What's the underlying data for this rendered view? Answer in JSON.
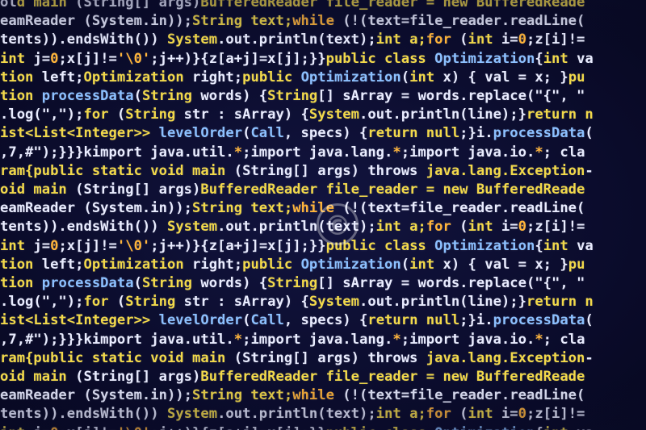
{
  "lines": [
    [
      [
        "w",
        "ol"
      ],
      [
        "y",
        "d main "
      ],
      [
        "w",
        "(String[] args)"
      ],
      [
        "y",
        "BufferedReader file_reader = new BufferedReade"
      ]
    ],
    [
      [
        "w",
        "eamReader (System.in));"
      ],
      [
        "y",
        "String text;"
      ],
      [
        "o",
        "while"
      ],
      [
        "w",
        " (!(text=file_reader.readLine("
      ]
    ],
    [
      [
        "w",
        "tents)).endsWith()) "
      ],
      [
        "y",
        "System"
      ],
      [
        "w",
        ".out.println(text);"
      ],
      [
        "y",
        "int a;"
      ],
      [
        "o",
        "for"
      ],
      [
        "w",
        " ("
      ],
      [
        "y",
        "int"
      ],
      [
        "w",
        " i="
      ],
      [
        "o",
        "0"
      ],
      [
        "w",
        ";z[i]!="
      ]
    ],
    [
      [
        "y",
        "int"
      ],
      [
        "w",
        " j="
      ],
      [
        "o",
        "0"
      ],
      [
        "w",
        ";x[j]!="
      ],
      [
        "o",
        "'\\0'"
      ],
      [
        "w",
        ";j++)}{z[a+j]=x[j];}}"
      ],
      [
        "y",
        "public class "
      ],
      [
        "b",
        "Optimization"
      ],
      [
        "w",
        "{"
      ],
      [
        "y",
        "int"
      ],
      [
        "w",
        " va"
      ]
    ],
    [
      [
        "y",
        "tion"
      ],
      [
        "w",
        " left;"
      ],
      [
        "y",
        "Optimization"
      ],
      [
        "w",
        " right;"
      ],
      [
        "y",
        "public "
      ],
      [
        "b",
        "Optimization"
      ],
      [
        "w",
        "("
      ],
      [
        "y",
        "int"
      ],
      [
        "w",
        " x) { val = x; }"
      ],
      [
        "y",
        "pu"
      ]
    ],
    [
      [
        "y",
        "tion "
      ],
      [
        "b",
        "processData"
      ],
      [
        "w",
        "("
      ],
      [
        "y",
        "String"
      ],
      [
        "w",
        " words) {"
      ],
      [
        "y",
        "String"
      ],
      [
        "w",
        "[] sArray = words.replace(\"{\", \""
      ]
    ],
    [
      [
        "w",
        ".log(\",\");"
      ],
      [
        "y",
        "for"
      ],
      [
        "w",
        " ("
      ],
      [
        "y",
        "String"
      ],
      [
        "w",
        " str : sArray) {"
      ],
      [
        "y",
        "System"
      ],
      [
        "w",
        ".out.println(line);}"
      ],
      [
        "y",
        "return n"
      ]
    ],
    [
      [
        "y",
        "ist<List<Integer>> "
      ],
      [
        "b",
        "levelOrder"
      ],
      [
        "w",
        "("
      ],
      [
        "b",
        "Call"
      ],
      [
        "w",
        ", specs) {"
      ],
      [
        "y",
        "return null"
      ],
      [
        "w",
        ";}i."
      ],
      [
        "b",
        "processData"
      ],
      [
        "w",
        "("
      ]
    ],
    [
      [
        "w",
        ",7,#\");}}}kimport java.util."
      ],
      [
        "o",
        "*"
      ],
      [
        "w",
        ";import java.lang."
      ],
      [
        "o",
        "*"
      ],
      [
        "w",
        ";import java.io."
      ],
      [
        "o",
        "*"
      ],
      [
        "w",
        "; cla"
      ]
    ],
    [
      [
        "y",
        "ram{public static void main "
      ],
      [
        "w",
        "(String[] args) throws "
      ],
      [
        "y",
        "java.lang.Exception"
      ],
      [
        "w",
        "-"
      ]
    ],
    [
      [
        "y",
        "oid main "
      ],
      [
        "w",
        "(String[] args)"
      ],
      [
        "y",
        "BufferedReader file_reader = new BufferedReade"
      ]
    ],
    [
      [
        "w",
        "eamReader (System.in));"
      ],
      [
        "y",
        "String text;"
      ],
      [
        "o",
        "while"
      ],
      [
        "w",
        " (!(text=file_reader.readLine("
      ]
    ],
    [
      [
        "w",
        "tents)).endsWith()) "
      ],
      [
        "y",
        "System"
      ],
      [
        "w",
        ".out.println(text);"
      ],
      [
        "y",
        "int a;"
      ],
      [
        "o",
        "for"
      ],
      [
        "w",
        " ("
      ],
      [
        "y",
        "int"
      ],
      [
        "w",
        " i="
      ],
      [
        "o",
        "0"
      ],
      [
        "w",
        ";z[i]!="
      ]
    ],
    [
      [
        "y",
        "int"
      ],
      [
        "w",
        " j="
      ],
      [
        "o",
        "0"
      ],
      [
        "w",
        ";x[j]!="
      ],
      [
        "o",
        "'\\0'"
      ],
      [
        "w",
        ";j++)}{z[a+j]=x[j];}}"
      ],
      [
        "y",
        "public class "
      ],
      [
        "b",
        "Optimization"
      ],
      [
        "w",
        "{"
      ],
      [
        "y",
        "int"
      ],
      [
        "w",
        " va"
      ]
    ],
    [
      [
        "y",
        "tion"
      ],
      [
        "w",
        " left;"
      ],
      [
        "y",
        "Optimization"
      ],
      [
        "w",
        " right;"
      ],
      [
        "y",
        "public "
      ],
      [
        "b",
        "Optimization"
      ],
      [
        "w",
        "("
      ],
      [
        "y",
        "int"
      ],
      [
        "w",
        " x) { val = x; }"
      ],
      [
        "y",
        "pu"
      ]
    ],
    [
      [
        "y",
        "tion "
      ],
      [
        "b",
        "processData"
      ],
      [
        "w",
        "("
      ],
      [
        "y",
        "String"
      ],
      [
        "w",
        " words) {"
      ],
      [
        "y",
        "String"
      ],
      [
        "w",
        "[] sArray = words.replace(\"{\", \""
      ]
    ],
    [
      [
        "w",
        ".log(\",\");"
      ],
      [
        "y",
        "for"
      ],
      [
        "w",
        " ("
      ],
      [
        "y",
        "String"
      ],
      [
        "w",
        " str : sArray) {"
      ],
      [
        "y",
        "System"
      ],
      [
        "w",
        ".out.println(line);}"
      ],
      [
        "y",
        "return n"
      ]
    ],
    [
      [
        "y",
        "ist<List<Integer>> "
      ],
      [
        "b",
        "levelOrder"
      ],
      [
        "w",
        "("
      ],
      [
        "b",
        "Call"
      ],
      [
        "w",
        ", specs) {"
      ],
      [
        "y",
        "return null"
      ],
      [
        "w",
        ";}i."
      ],
      [
        "b",
        "processData"
      ],
      [
        "w",
        "("
      ]
    ],
    [
      [
        "w",
        ",7,#\");}}}kimport java.util."
      ],
      [
        "o",
        "*"
      ],
      [
        "w",
        ";import java.lang."
      ],
      [
        "o",
        "*"
      ],
      [
        "w",
        ";import java.io."
      ],
      [
        "o",
        "*"
      ],
      [
        "w",
        "; cla"
      ]
    ],
    [
      [
        "y",
        "ram{public static void main "
      ],
      [
        "w",
        "(String[] args) throws "
      ],
      [
        "y",
        "java.lang.Exception"
      ],
      [
        "w",
        "-"
      ]
    ],
    [
      [
        "y",
        "oid main "
      ],
      [
        "w",
        "(String[] args)"
      ],
      [
        "y",
        "BufferedReader file_reader = new BufferedReade"
      ]
    ],
    [
      [
        "w",
        "eamReader (System.in));"
      ],
      [
        "y",
        "String text;"
      ],
      [
        "o",
        "while"
      ],
      [
        "w",
        " (!(text=file_reader.readLine("
      ]
    ],
    [
      [
        "w",
        "tents)).endsWith()) "
      ],
      [
        "y",
        "System"
      ],
      [
        "w",
        ".out.println(text);"
      ],
      [
        "y",
        "int a;"
      ],
      [
        "o",
        "for"
      ],
      [
        "w",
        " ("
      ],
      [
        "y",
        "int"
      ],
      [
        "w",
        " i="
      ],
      [
        "o",
        "0"
      ],
      [
        "w",
        ";z[i]!="
      ]
    ],
    [
      [
        "y",
        "int"
      ],
      [
        "w",
        " j="
      ],
      [
        "o",
        "0"
      ],
      [
        "w",
        ";x[j]!="
      ],
      [
        "o",
        "'\\0'"
      ],
      [
        "w",
        ";j++)}{z[a+j]=x[j];}}"
      ],
      [
        "y",
        "public class "
      ],
      [
        "b",
        "Optimization"
      ],
      [
        "w",
        "{"
      ],
      [
        "y",
        "int"
      ],
      [
        "w",
        " va"
      ]
    ]
  ],
  "watermark": "©",
  "colors": {
    "background": "#0b0c2e",
    "white_text": "#e9ecff",
    "yellow_text": "#f2d94a",
    "orange_text": "#ffb43a",
    "blue_text": "#8cc0ff"
  }
}
